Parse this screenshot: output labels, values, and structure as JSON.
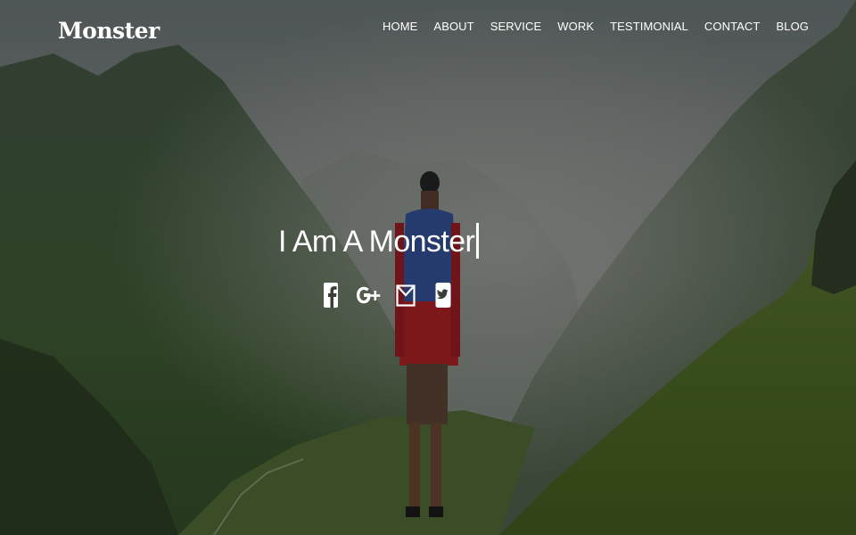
{
  "brand": {
    "name": "Monster"
  },
  "nav": {
    "items": [
      {
        "label": "HOME"
      },
      {
        "label": "ABOUT"
      },
      {
        "label": "SERVICE"
      },
      {
        "label": "WORK"
      },
      {
        "label": "TESTIMONIAL"
      },
      {
        "label": "CONTACT"
      },
      {
        "label": "BLOG"
      }
    ]
  },
  "hero": {
    "headline": "I Am A Monster",
    "socials": [
      {
        "icon": "facebook-icon"
      },
      {
        "icon": "google-plus-icon"
      },
      {
        "icon": "email-icon"
      },
      {
        "icon": "twitter-icon"
      }
    ]
  },
  "colors": {
    "text": "#ffffff",
    "jacket_top": "#3d5fb0",
    "jacket_bottom": "#c8262a"
  }
}
